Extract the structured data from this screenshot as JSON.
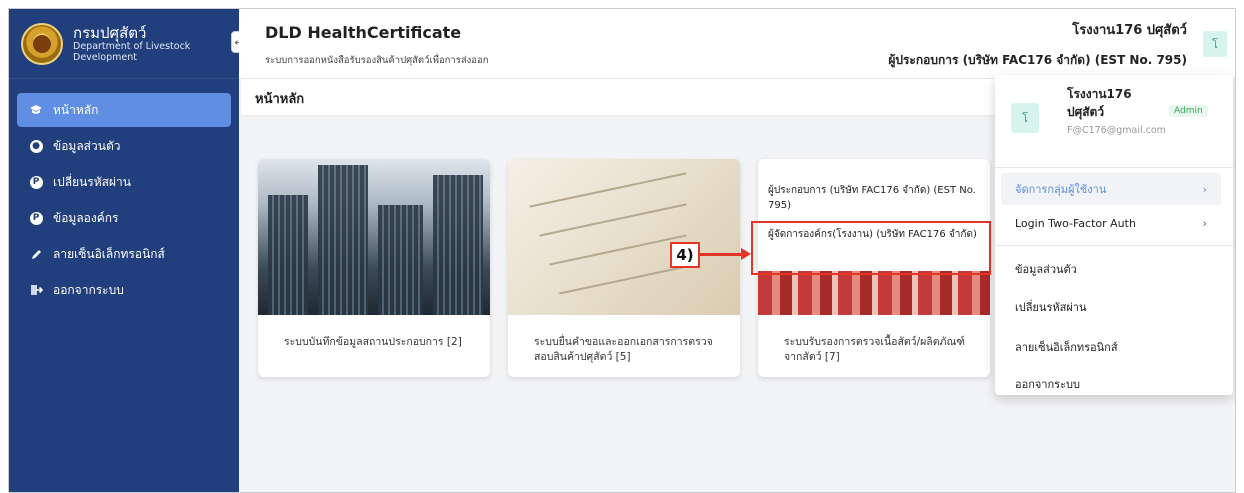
{
  "sidebar": {
    "brand_th": "กรมปศุสัตว์",
    "brand_en_1": "Department of Livestock",
    "brand_en_2": "Development",
    "collapse_label": "←",
    "items": [
      {
        "label": "หน้าหลัก",
        "icon": "graduation-cap-icon"
      },
      {
        "label": "ข้อมูลส่วนตัว",
        "icon": "user-icon"
      },
      {
        "label": "เปลี่ยนรหัสผ่าน",
        "icon": "key-icon"
      },
      {
        "label": "ข้อมูลองค์กร",
        "icon": "key-icon"
      },
      {
        "label": "ลายเซ็นอิเล็กทรอนิกส์",
        "icon": "pen-icon"
      },
      {
        "label": "ออกจากระบบ",
        "icon": "logout-icon"
      }
    ]
  },
  "header": {
    "title": "DLD HealthCertificate",
    "subtitle": "ระบบการออกหนังสือรับรองสินค้าปศุสัตว์เพื่อการส่งออก",
    "user_name": "โรงงาน176 ปศุสัตว์",
    "user_role": "ผู้ประกอบการ (บริษัท FAC176 จำกัด) (EST No. 795)",
    "avatar_letter": "โ"
  },
  "page": {
    "title": "หน้าหลัก"
  },
  "cards": [
    {
      "label": "ระบบบันทึกข้อมูลสถานประกอบการ [2]"
    },
    {
      "label": "ระบบยื่นคำขอและออกเอกสารการตรวจสอบสินค้าปศุสัตว์ [5]"
    },
    {
      "label": "ระบบรับรองการตรวจเนื้อสัตว์/ผลิตภัณฑ์จากสัตว์ [7]"
    }
  ],
  "role_dropdown": {
    "options": [
      "ผู้ประกอบการ (บริษัท FAC176 จำกัด) (EST No. 795)",
      "ผู้จัดการองค์กร(โรงงาน) (บริษัท FAC176 จำกัด)"
    ]
  },
  "annotation": {
    "label": "4)"
  },
  "user_menu": {
    "avatar_letter": "โ",
    "name": "โรงงาน176 ปศุสัตว์",
    "email": "F@C176@gmail.com",
    "badge": "Admin",
    "items": [
      {
        "label": "จัดการกลุ่มผู้ใช้งาน",
        "chevron": "›"
      },
      {
        "label": "Login Two-Factor Auth",
        "chevron": "›"
      },
      {
        "label": "ข้อมูลส่วนตัว"
      },
      {
        "label": "เปลี่ยนรหัสผ่าน"
      },
      {
        "label": "ลายเซ็นอิเล็กทรอนิกส์"
      },
      {
        "label": "ออกจากระบบ"
      }
    ]
  },
  "colors": {
    "sidebar_bg": "#203f7c",
    "active_item": "#5f8ee3",
    "annotation": "#e53527",
    "admin_badge": "#34a853"
  }
}
